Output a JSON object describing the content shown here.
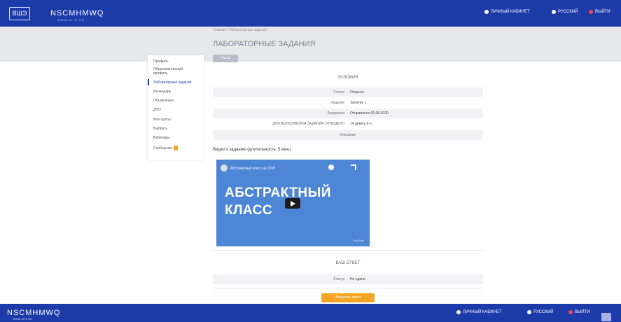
{
  "header": {
    "logo_text": "ВШЭ",
    "brand": "NSCMHMWQ",
    "brand_sub": "WWW.SITE.RU",
    "nav": [
      {
        "label": "ЛИЧНЫЙ КАБИНЕТ",
        "icon": "user-icon"
      },
      {
        "label": "РУССКИЙ",
        "icon": "globe-icon"
      },
      {
        "label": "ВЫЙТИ",
        "icon": "exit-icon"
      }
    ]
  },
  "breadcrumb": "Главная / Лабораторные задания",
  "page_title": "ЛАБОРАТОРНЫЕ ЗАДАНИЯ",
  "back_button": "Назад",
  "sidebar": {
    "items": [
      "Профиль",
      "Образовательный",
      "профиль",
      "Лабораторные задания",
      "Календарь",
      "Объявления",
      "ДПО",
      "Мои курсы",
      "Выбрать",
      "Вебинары",
      "Сообщения"
    ]
  },
  "info": {
    "section_title": "УСЛОВИЯ",
    "rows": [
      {
        "key": "Статус",
        "value": "Открыто"
      },
      {
        "key": "Задание",
        "value": "Занятие 1"
      },
      {
        "key": "Загружено",
        "value": "Отправлено 09.08.2020"
      },
      {
        "key": "ДЛЯ ВЫПОЛНЕНИЯ ЗАДАНИЯ ОТВЕДЕНО",
        "value": "14 дней и 6 ч"
      },
      {
        "center": "Описание"
      }
    ]
  },
  "video": {
    "label": "Видео к заданию (длительность: 5 мин.)",
    "channel_title": "Абстрактный класс на ООП",
    "line1": "АБСТРАКТНЫЙ",
    "line2": "КЛАСС",
    "yt_mark": "YouTube"
  },
  "answer": {
    "section_title": "ВАШ ОТВЕТ",
    "status_key": "Статус",
    "status_value": "Не сдано"
  },
  "submit_button": "Загрузить ответ",
  "footer": {
    "brand": "NSCMHMWQ",
    "brand_sub": "WWW.SITE.RU",
    "nav": [
      {
        "label": "ЛИЧНЫЙ КАБИНЕТ"
      },
      {
        "label": "РУССКИЙ"
      },
      {
        "label": "ВЫЙТИ"
      }
    ]
  }
}
